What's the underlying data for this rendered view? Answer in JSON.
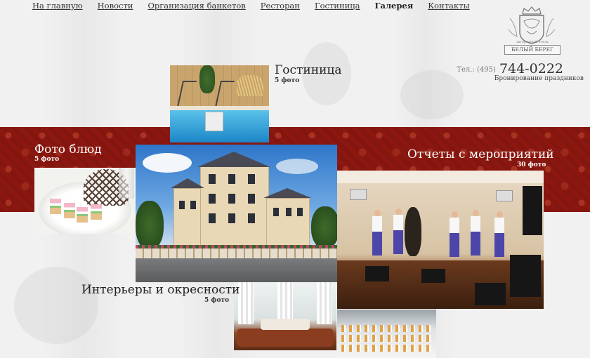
{
  "nav": {
    "items": [
      {
        "label": "На главную",
        "active": false
      },
      {
        "label": "Новости",
        "active": false
      },
      {
        "label": "Организация банкетов",
        "active": false
      },
      {
        "label": "Ресторан",
        "active": false
      },
      {
        "label": "Гостиница",
        "active": false
      },
      {
        "label": "Галерея",
        "active": true
      },
      {
        "label": "Контакты",
        "active": false
      }
    ]
  },
  "logo": {
    "tagline": "загородный отель",
    "name": "БЕЛЫЙ БЕРЕГ",
    "icon": "crest-icon"
  },
  "contact": {
    "phone_prefix": "Тел.: (495)",
    "phone_number": "744-0222",
    "subtitle": "Бронирование праздников"
  },
  "gallery": {
    "albums": [
      {
        "title": "Гостиница",
        "count": "5 фото"
      },
      {
        "title": "Фото блюд",
        "count": "5 фото"
      },
      {
        "title": "Отчеты с мероприятий",
        "count": "30 фото"
      },
      {
        "title": "Интерьеры и окресности",
        "count": "5 фото"
      }
    ]
  },
  "colors": {
    "band": "#8b1710",
    "text": "#222222",
    "background": "#f1f1f1"
  }
}
